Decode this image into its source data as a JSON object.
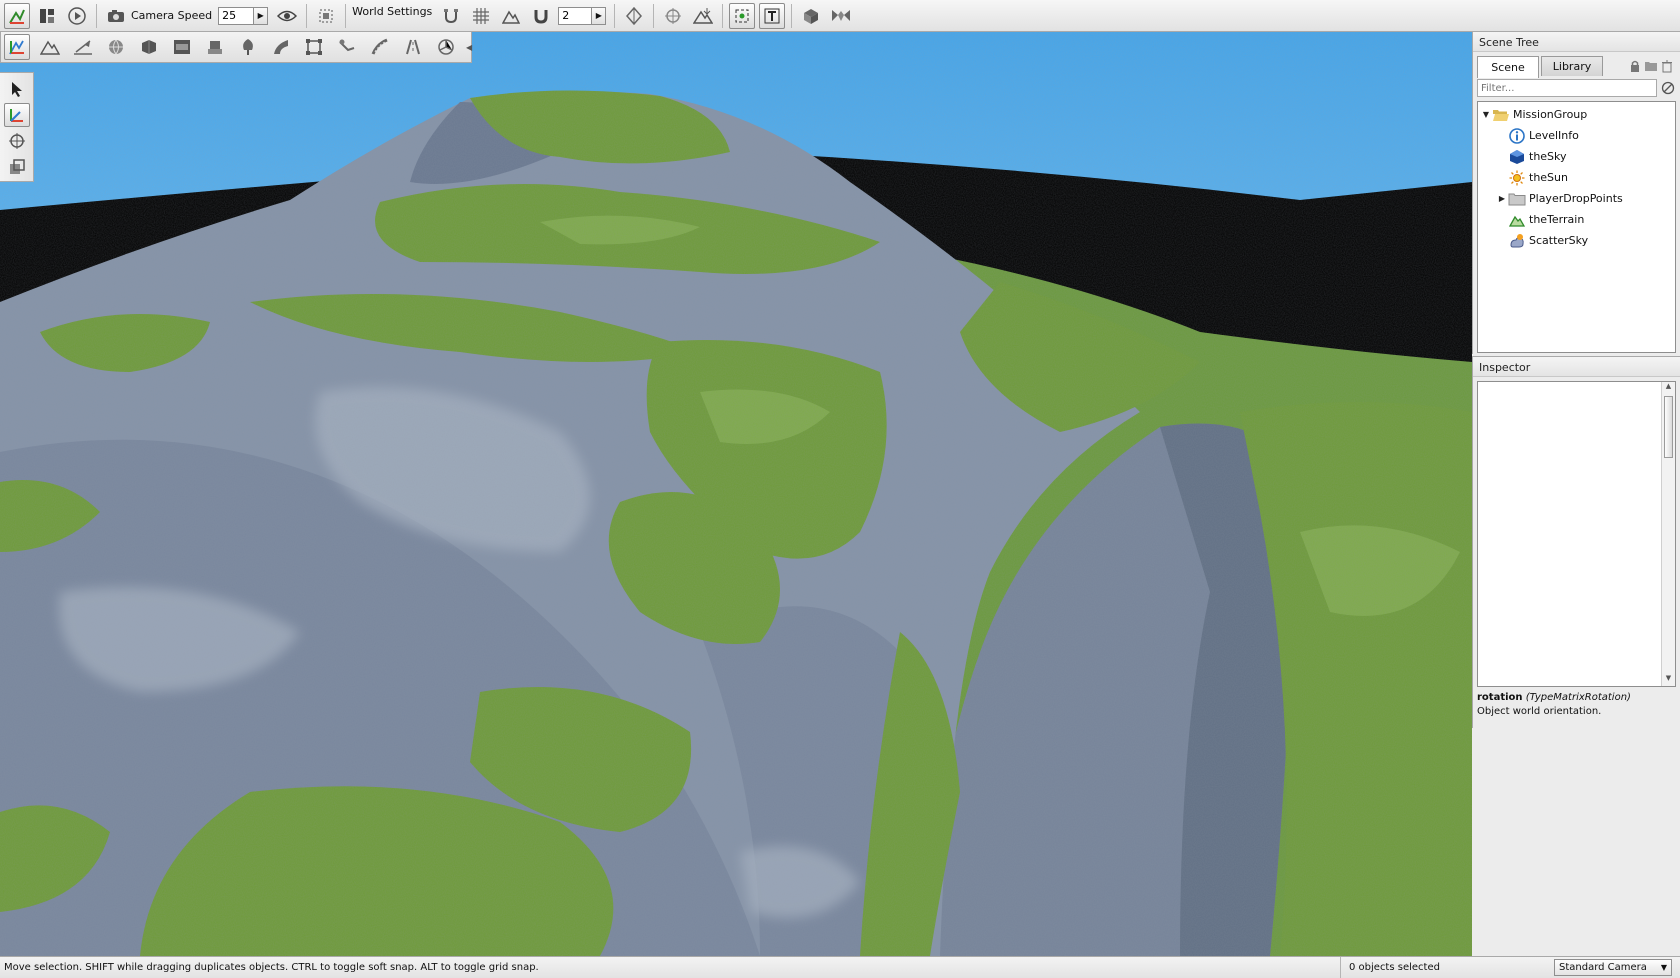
{
  "toolbar": {
    "camera_speed_label": "Camera Speed",
    "camera_speed_value": "25",
    "world_settings_label": "World Settings",
    "snap_value": "2"
  },
  "scene_tree": {
    "title": "Scene Tree",
    "tabs": [
      "Scene",
      "Library"
    ],
    "filter_placeholder": "Filter...",
    "items": [
      {
        "label": "MissionGroup",
        "icon": "open-folder-icon",
        "expanded": true
      },
      {
        "label": "LevelInfo",
        "icon": "info-icon"
      },
      {
        "label": "theSky",
        "icon": "sky-cube-icon"
      },
      {
        "label": "theSun",
        "icon": "sun-icon"
      },
      {
        "label": "PlayerDropPoints",
        "icon": "folder-icon",
        "expanded": false
      },
      {
        "label": "theTerrain",
        "icon": "terrain-icon"
      },
      {
        "label": "ScatterSky",
        "icon": "scatter-sky-icon"
      }
    ]
  },
  "inspector": {
    "title": "Inspector",
    "field_name": "rotation",
    "field_type": "(TypeMatrixRotation)",
    "field_desc": "Object world orientation."
  },
  "status": {
    "message": "Move selection.  SHIFT while dragging duplicates objects.  CTRL to toggle soft snap.  ALT to toggle grid snap.",
    "selection": "0 objects selected",
    "camera": "Standard Camera"
  },
  "colors": {
    "sky": "#5fb8ee",
    "grass": "#6f9a3c",
    "rock": "#7d8ea5",
    "accent": "#2a74c6"
  }
}
